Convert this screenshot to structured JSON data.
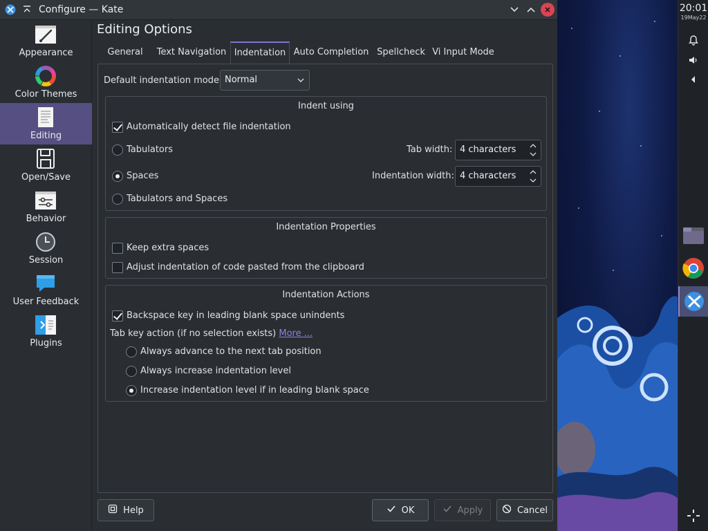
{
  "window": {
    "title": "Configure — Kate",
    "page_title": "Editing Options"
  },
  "sidebar": {
    "items": [
      {
        "label": "Appearance",
        "icon": "brush-icon"
      },
      {
        "label": "Color Themes",
        "icon": "color-wheel-icon"
      },
      {
        "label": "Editing",
        "icon": "document-text-icon",
        "active": true
      },
      {
        "label": "Open/Save",
        "icon": "floppy-disk-icon"
      },
      {
        "label": "Behavior",
        "icon": "sliders-icon"
      },
      {
        "label": "Session",
        "icon": "clock-icon"
      },
      {
        "label": "User Feedback",
        "icon": "speech-bubble-icon"
      },
      {
        "label": "Plugins",
        "icon": "puzzle-plugin-icon"
      }
    ]
  },
  "tabs": [
    {
      "label": "General"
    },
    {
      "label": "Text Navigation"
    },
    {
      "label": "Indentation",
      "active": true
    },
    {
      "label": "Auto Completion"
    },
    {
      "label": "Spellcheck"
    },
    {
      "label": "Vi Input Mode"
    }
  ],
  "indentation": {
    "default_mode_label": "Default indentation mode:",
    "default_mode_value": "Normal",
    "indent_using": {
      "title": "Indent using",
      "auto_detect_label": "Automatically detect file indentation",
      "auto_detect_checked": true,
      "tabulators_label": "Tabulators",
      "spaces_label": "Spaces",
      "tabs_and_spaces_label": "Tabulators and Spaces",
      "selected": "Spaces",
      "tab_width_label": "Tab width:",
      "tab_width_value": "4 characters",
      "indent_width_label": "Indentation width:",
      "indent_width_value": "4 characters"
    },
    "properties": {
      "title": "Indentation Properties",
      "keep_extra_spaces_label": "Keep extra spaces",
      "keep_extra_spaces_checked": false,
      "adjust_pasted_label": "Adjust indentation of code pasted from the clipboard",
      "adjust_pasted_checked": false
    },
    "actions": {
      "title": "Indentation Actions",
      "backspace_label": "Backspace key in leading blank space unindents",
      "backspace_checked": true,
      "tab_key_label": "Tab key action (if no selection exists)",
      "more_link": "More ...",
      "opt_advance": "Always advance to the next tab position",
      "opt_increase": "Always increase indentation level",
      "opt_increase_if_blank": "Increase indentation level if in leading blank space",
      "selected": "Increase indentation level if in leading blank space"
    }
  },
  "buttons": {
    "help": "Help",
    "ok": "OK",
    "apply": "Apply",
    "cancel": "Cancel"
  },
  "panel": {
    "time": "20:01",
    "date": "19May22"
  },
  "colors": {
    "accent": "#7f74d1",
    "sidebar_active": "#554f82",
    "window_bg": "#2a2e32",
    "close_button": "#da4453"
  }
}
